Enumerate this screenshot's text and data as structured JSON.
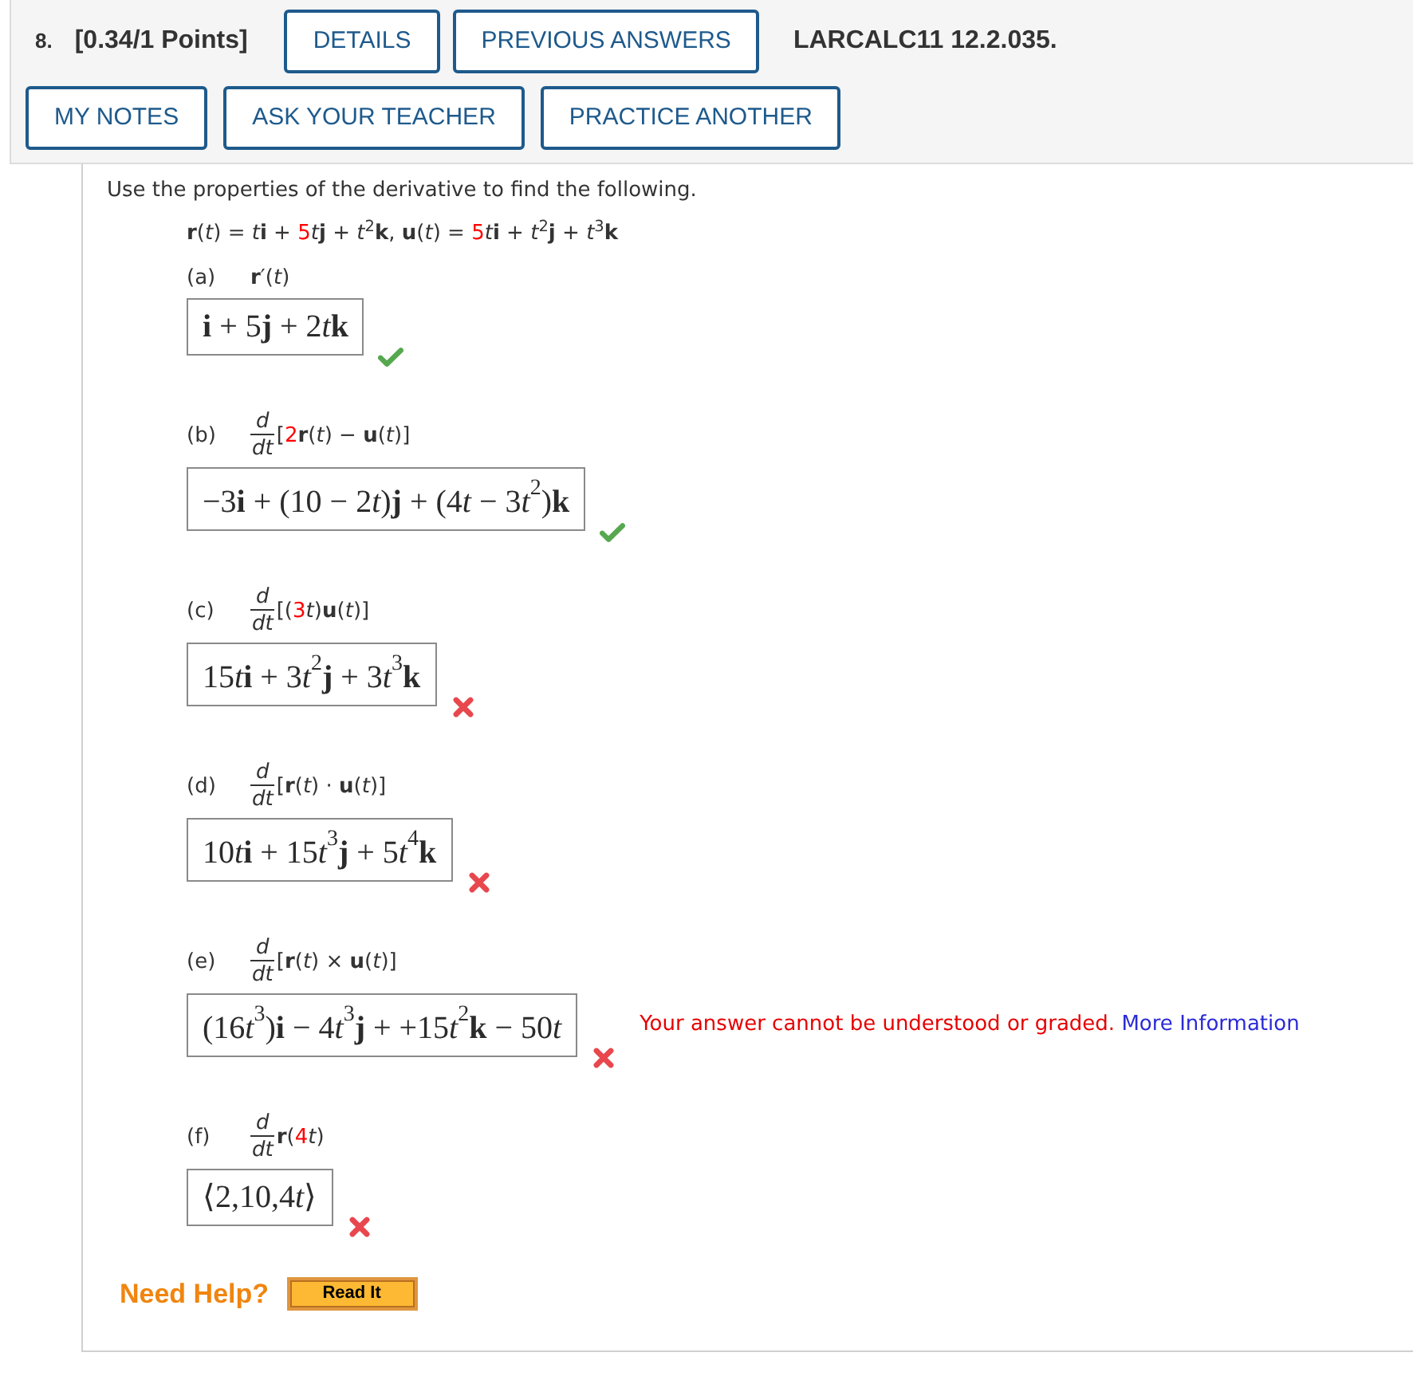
{
  "header": {
    "number": "8.",
    "points": "[0.34/1 Points]",
    "buttons_row_1": [
      "DETAILS",
      "PREVIOUS ANSWERS"
    ],
    "reference": "LARCALC11 12.2.035.",
    "buttons_row_2": [
      "MY NOTES",
      "ASK YOUR TEACHER",
      "PRACTICE ANOTHER"
    ]
  },
  "question": {
    "instruction": "Use the properties of the derivative to find the following.",
    "given": [
      {
        "text": "**r**(*t*) = *t*",
        "highlighted": false
      },
      {
        "text": "**i** + ",
        "highlighted": false
      },
      {
        "text": "5",
        "highlighted": true
      },
      {
        "text": "*t*",
        "highlighted": false
      },
      {
        "text": "**j** + *t*$^{2}$",
        "highlighted": false
      },
      {
        "text": "**k**, **u**(*t*) = ",
        "highlighted": false
      },
      {
        "text": "5",
        "highlighted": true
      },
      {
        "text": "*t*",
        "highlighted": false
      },
      {
        "text": "**i** + *t*$^{2}$",
        "highlighted": false
      },
      {
        "text": "**j** + *t*$^{3}$",
        "highlighted": false
      },
      {
        "text": "**k**",
        "highlighted": false
      }
    ],
    "parts": [
      {
        "label": "(a)",
        "expression": [
          {
            "text": "**r**′(*t*)",
            "highlighted": false
          }
        ],
        "answer": [
          "**i** + 5**j** + 2",
          "*t*",
          "**k**"
        ],
        "correct": true
      },
      {
        "label": "(b)",
        "derivative": {
          "numerator": "d",
          "denominator": "dt"
        },
        "expression": [
          {
            "text": "[",
            "highlighted": false
          },
          {
            "text": "2",
            "highlighted": true
          },
          {
            "text": "**r**(*t*) − **u**(*t*)]",
            "highlighted": false
          }
        ],
        "answer": [
          "−3**i** + (10 − 2",
          "*t*)**j** + (4",
          "*t* − 3",
          "*t*$^{2}$)**k**"
        ],
        "correct": true
      },
      {
        "label": "(c)",
        "derivative": {
          "numerator": "d",
          "denominator": "dt"
        },
        "expression": [
          {
            "text": "[(",
            "highlighted": false
          },
          {
            "text": "3",
            "highlighted": true
          },
          {
            "text": "*t*)**u**(*t*)]",
            "highlighted": false
          }
        ],
        "answer": [
          "15",
          "*t*",
          "**i** + 3",
          "*t*$^{2}$**j** + 3",
          "*t*$^{3}$**k**"
        ],
        "correct": false
      },
      {
        "label": "(d)",
        "derivative": {
          "numerator": "d",
          "denominator": "dt"
        },
        "expression": [
          {
            "text": "[**r**(*t*) · **u**(*t*)]",
            "highlighted": false
          }
        ],
        "answer": [
          "10",
          "*t*",
          "**i** + 15",
          "*t*$^{3}$**j** + 5",
          "*t*$^{4}$**k**"
        ],
        "correct": false
      },
      {
        "label": "(e)",
        "derivative": {
          "numerator": "d",
          "denominator": "dt"
        },
        "expression": [
          {
            "text": "[**r**(*t*) × **u**(*t*)]",
            "highlighted": false
          }
        ],
        "answer": [
          "(16",
          "*t*$^{3}$)**i** − 4",
          "*t*$^{3}$**j** + +15",
          "*t*$^{2}$**k** − 50",
          "*t*"
        ],
        "correct": false,
        "message": {
          "text": "Your answer cannot be understood or graded.",
          "link": "More Information"
        }
      },
      {
        "label": "(f)",
        "derivative": {
          "numerator": "d",
          "denominator": "dt"
        },
        "expression": [
          {
            "text": "**r**(",
            "highlighted": false
          },
          {
            "text": "4",
            "highlighted": true
          },
          {
            "text": "*t*)",
            "highlighted": false
          }
        ],
        "answer": [
          "⟨2,10,4",
          "*t*⟩"
        ],
        "correct": false
      }
    ]
  },
  "help": {
    "label": "Need Help?",
    "buttons": [
      "Read It"
    ]
  }
}
